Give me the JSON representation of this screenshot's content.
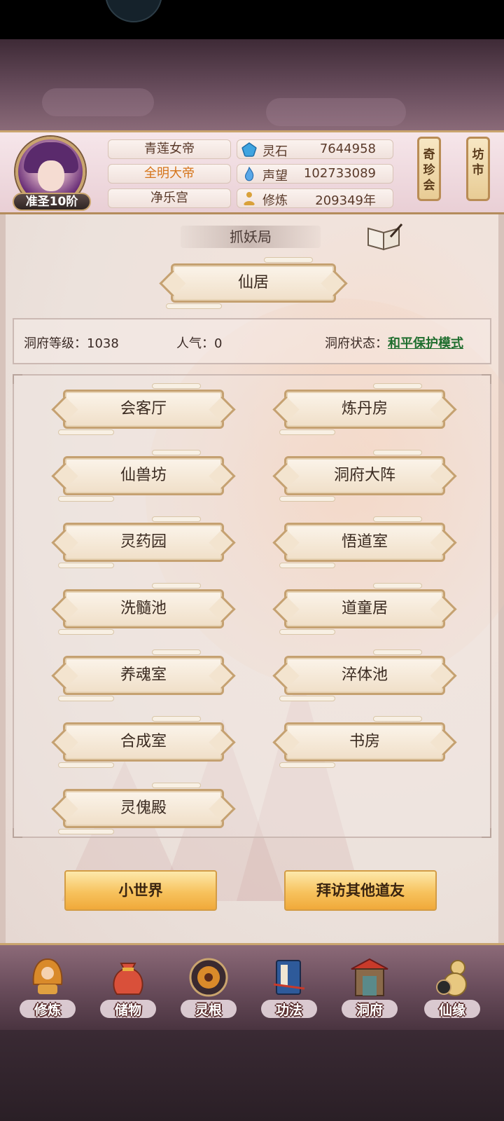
{
  "player": {
    "rank": "准圣10阶",
    "titles": [
      "青莲女帝",
      "全明大帝",
      "净乐宫"
    ]
  },
  "stats": [
    {
      "label": "灵石",
      "value": "7644958",
      "icon": "spirit-stone-icon",
      "color": "#3fa4e0"
    },
    {
      "label": "声望",
      "value": "102733089",
      "icon": "prestige-flame-icon",
      "color": "#5aa8e8"
    },
    {
      "label": "修炼",
      "value": "209349年",
      "icon": "meditation-icon",
      "color": "#d9a13a"
    }
  ],
  "side_buttons": {
    "treasure": "奇珍会",
    "market": "坊市"
  },
  "section_title": "抓妖局",
  "main_banner": "仙居",
  "estate": {
    "level_label": "洞府等级：",
    "level_value": "1038",
    "popularity_label": "人气：",
    "popularity_value": "0",
    "status_label": "洞府状态：",
    "status_value": "和平保护模式"
  },
  "rooms": [
    "会客厅",
    "炼丹房",
    "仙兽坊",
    "洞府大阵",
    "灵药园",
    "悟道室",
    "洗髓池",
    "道童居",
    "养魂室",
    "淬体池",
    "合成室",
    "书房",
    "灵傀殿"
  ],
  "actions": {
    "small_world": "小世界",
    "visit": "拜访其他道友"
  },
  "nav": [
    {
      "label": "修炼",
      "icon": "cultivate-icon"
    },
    {
      "label": "储物",
      "icon": "storage-bag-icon"
    },
    {
      "label": "灵根",
      "icon": "spirit-root-icon"
    },
    {
      "label": "功法",
      "icon": "technique-book-icon"
    },
    {
      "label": "洞府",
      "icon": "cave-mansion-icon"
    },
    {
      "label": "仙缘",
      "icon": "immortal-fate-icon"
    }
  ]
}
